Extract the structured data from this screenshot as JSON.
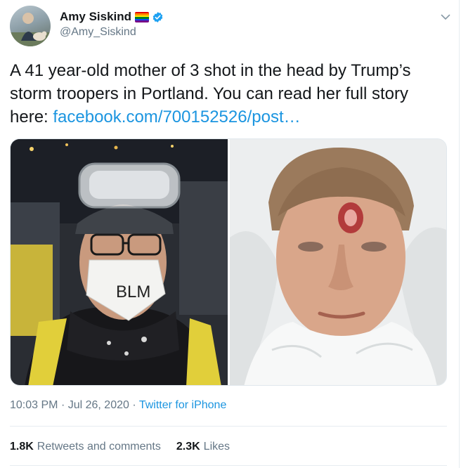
{
  "author": {
    "name": "Amy Siskind",
    "handle": "@Amy_Siskind",
    "badges": [
      "rainbow-flag-icon",
      "verified-badge-icon"
    ]
  },
  "tweet": {
    "text_before_link": "A 41 year-old mother of 3 shot in the head by Trump’s storm troopers in Portland. You can read her full story here: ",
    "link_text": "facebook.com/700152526/post…"
  },
  "media": {
    "count": 2,
    "left_photo_mask_text": "BLM"
  },
  "meta": {
    "time": "10:03 PM",
    "separator": "·",
    "date": "Jul 26, 2020",
    "source": "Twitter for iPhone"
  },
  "stats": {
    "retweets_count": "1.8K",
    "retweets_label": "Retweets and comments",
    "likes_count": "2.3K",
    "likes_label": "Likes"
  },
  "colors": {
    "link": "#1b95e0",
    "text": "#14171a",
    "muted": "#657786",
    "verified": "#1da1f2"
  }
}
